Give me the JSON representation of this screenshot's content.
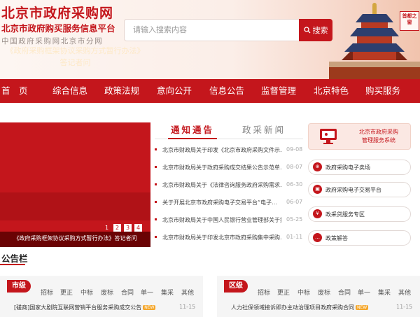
{
  "header": {
    "title": "北京市政府采购网",
    "subtitle": "北京市政府购买服务信息平台",
    "branch": "中国政府采购网北京市分网",
    "search_placeholder": "请输入搜索内容",
    "search_button": "搜索",
    "seal_text": "首都之窗"
  },
  "nav": {
    "items": [
      "首　页",
      "综合信息",
      "政策法规",
      "意向公开",
      "信息公告",
      "监督管理",
      "北京特色",
      "购买服务"
    ]
  },
  "banner": {
    "title": "《政府采购框架协议采购方式暂行办法》",
    "subtitle": "答记者问",
    "caption": "《政府采购框架协议采购方式暂行办法》答记者问",
    "pager": [
      "1",
      "2",
      "3",
      "4"
    ]
  },
  "news": {
    "tabs": [
      "通知通告",
      "政采新闻"
    ],
    "items": [
      {
        "title": "北京市财政局关于印发《北京市政府采购文件示…",
        "date": "09-08"
      },
      {
        "title": "北京市财政局关于政府采购成交结果公告示范单…",
        "date": "08-07"
      },
      {
        "title": "北京市财政局关于《法律咨询服务政府采购需求…",
        "date": "06-30"
      },
      {
        "title": "关于开展北京市政府采购电子交易平台“电子…",
        "date": "06-07"
      },
      {
        "title": "北京市财政局关于中国人民银行营业管理部关于推…",
        "date": "05-25"
      },
      {
        "title": "北京市财政局关于印发北京市政府采购集中采购…",
        "date": "01-11"
      }
    ]
  },
  "right_panel": {
    "system_title_line1": "北京市政府采购",
    "system_title_line2": "管理服务系统",
    "links": [
      {
        "label": "政府采购电子卖场",
        "icon": "cart-icon"
      },
      {
        "label": "政府采购电子交易平台",
        "icon": "monitor-icon"
      },
      {
        "label": "政采贷服务专区",
        "icon": "coin-icon"
      },
      {
        "label": "政策解答",
        "icon": "chat-icon"
      }
    ]
  },
  "announcements": {
    "title": "公告栏",
    "city": {
      "badge": "市级",
      "filters": [
        "招标",
        "更正",
        "中标",
        "废标",
        "合同",
        "单一",
        "集采",
        "其他"
      ],
      "first_item": "[磋商]国家大剧院互联网营销平台服务采购成交公告",
      "first_date": "11-15",
      "new_tag": "NEW"
    },
    "district": {
      "badge": "区级",
      "filters": [
        "招标",
        "更正",
        "中标",
        "废标",
        "合同",
        "单一",
        "集采",
        "其他"
      ],
      "first_item": "人力社保领域接诉即办主动治理项目政府采购合同",
      "first_date": "11-15",
      "new_tag": "NEW"
    }
  },
  "colors": {
    "brand_red": "#c4161c",
    "nav_red": "#c4161c",
    "panel_gray": "#f5f5f5"
  }
}
